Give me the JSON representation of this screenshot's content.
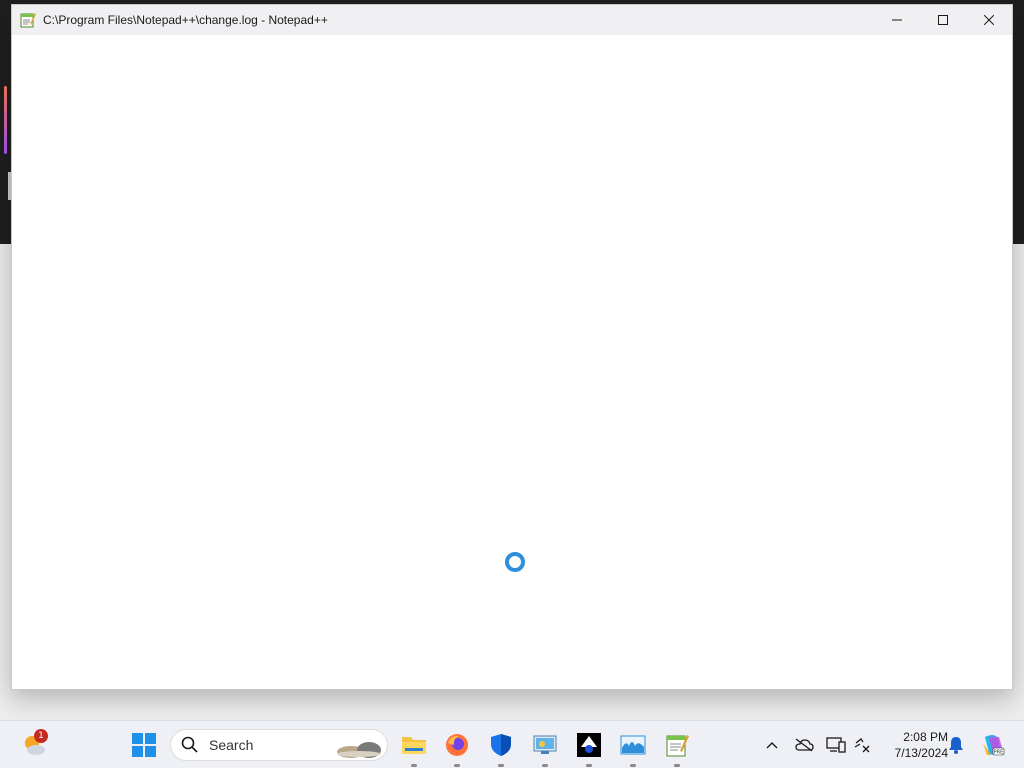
{
  "window": {
    "title": "C:\\Program Files\\Notepad++\\change.log - Notepad++",
    "controls": [
      "minimize",
      "maximize",
      "close"
    ]
  },
  "content": {
    "state": "loading"
  },
  "taskbar": {
    "weather_badge": "1",
    "search_label": "Search",
    "pinned_apps": [
      {
        "name": "file-explorer",
        "running": true
      },
      {
        "name": "firefox",
        "running": true
      },
      {
        "name": "windows-security",
        "running": true
      },
      {
        "name": "control-panel",
        "running": true
      },
      {
        "name": "inkscape",
        "running": true
      },
      {
        "name": "app-blue-wave",
        "running": true
      },
      {
        "name": "notepad-plus-plus",
        "running": true
      }
    ],
    "clock": {
      "time": "2:08 PM",
      "date": "7/13/2024"
    }
  },
  "colors": {
    "accent": "#2e8fdb",
    "taskbar_bg": "#eef0f5",
    "badge": "#c42b1c"
  }
}
